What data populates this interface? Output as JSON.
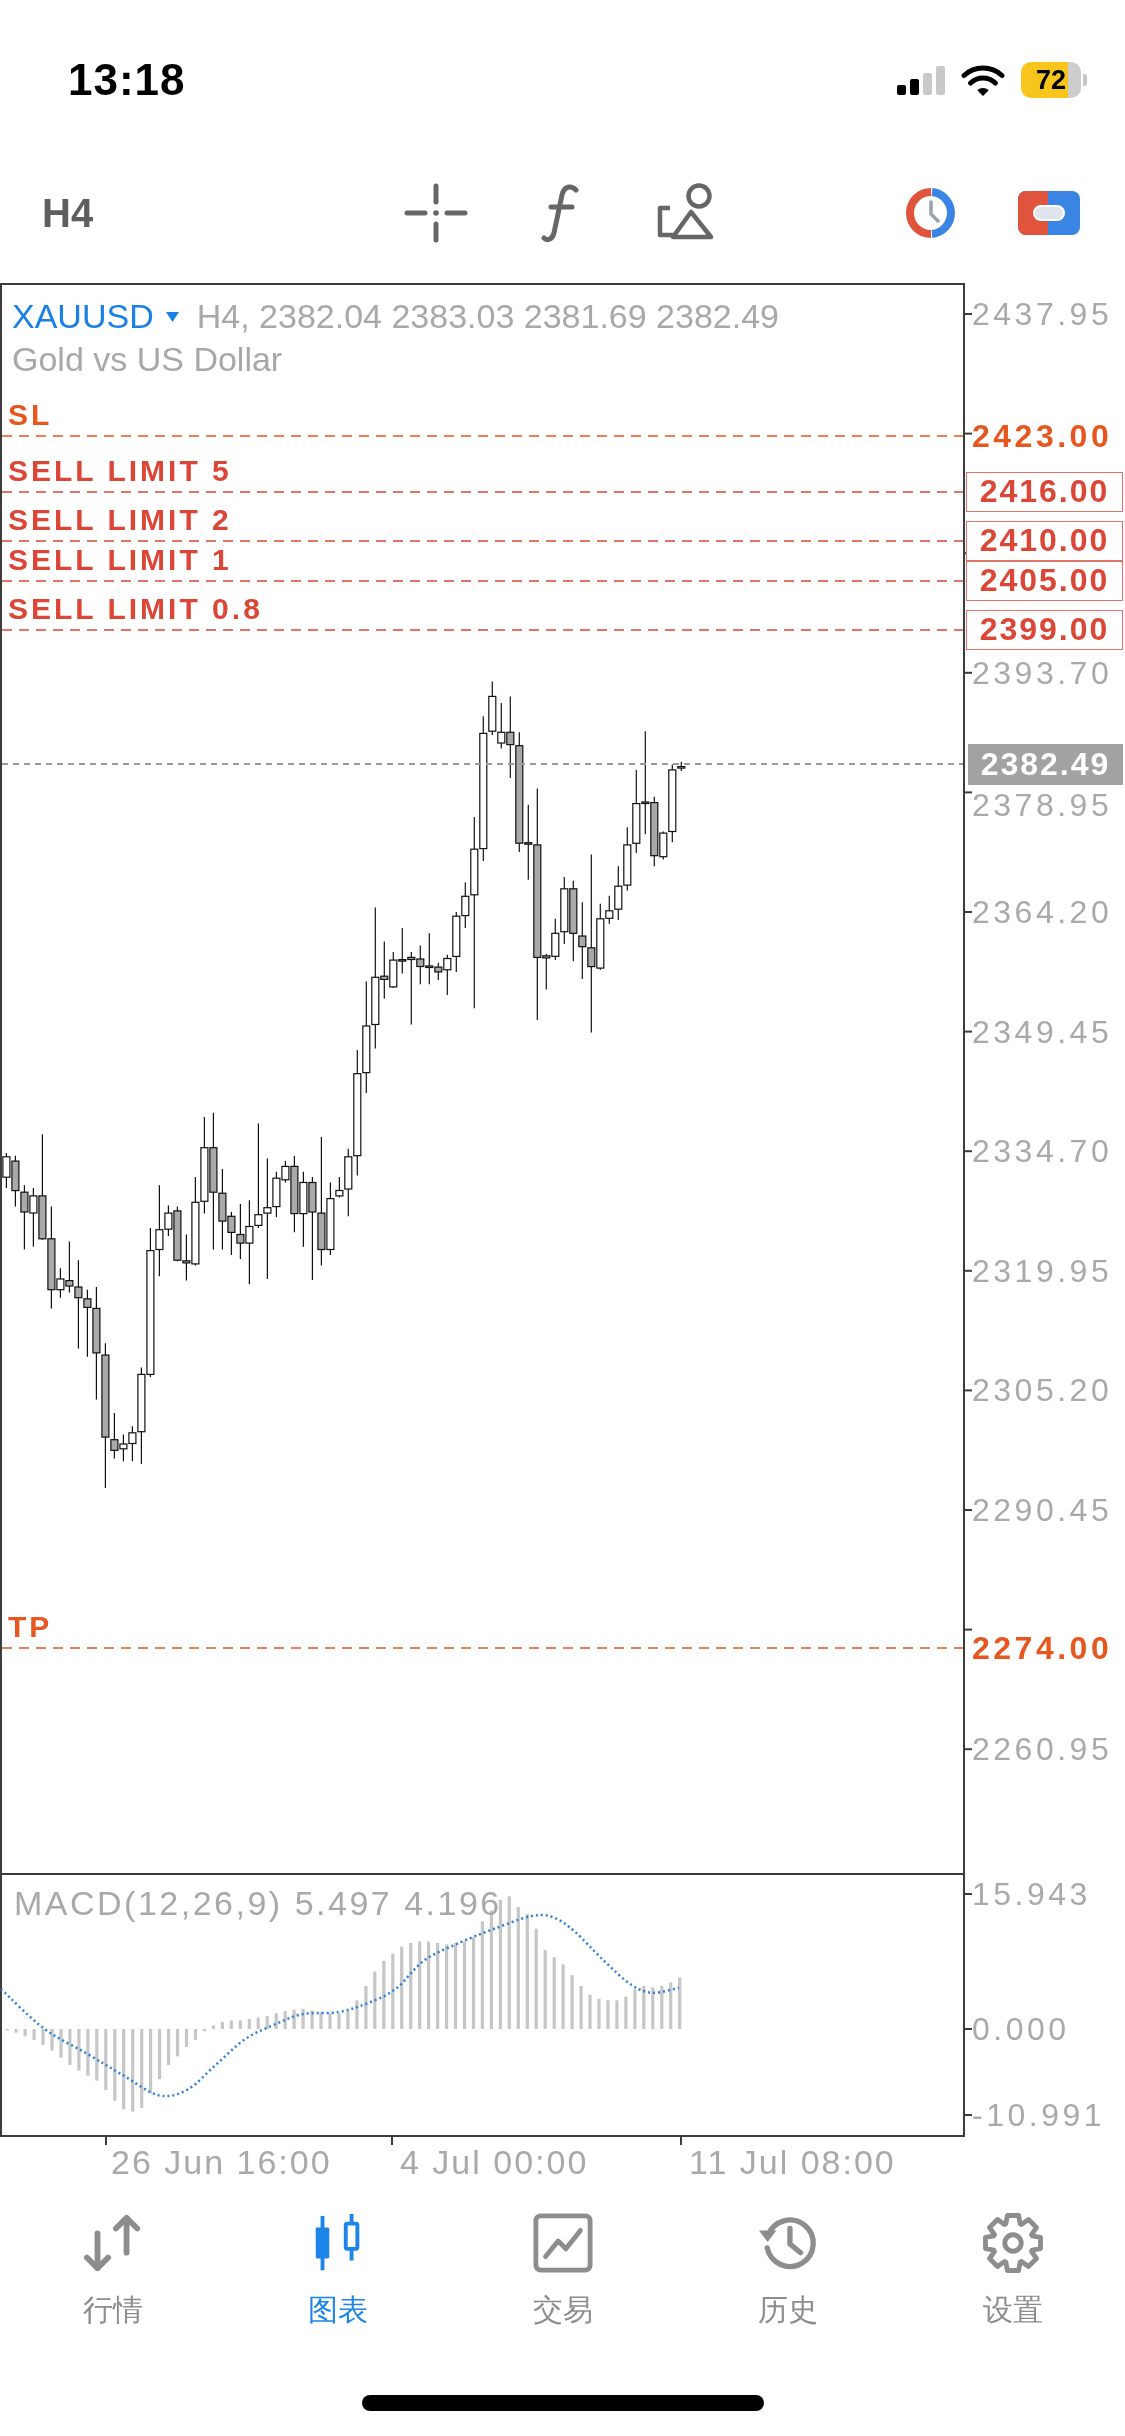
{
  "status_bar": {
    "time": "13:18",
    "battery": "72"
  },
  "toolbar": {
    "timeframe": "H4"
  },
  "chart": {
    "symbol": "XAUUSD",
    "quote": "H4, 2382.04 2383.03 2381.69 2382.49",
    "description": "Gold vs US Dollar",
    "order_lines": [
      {
        "label": "SL",
        "price": "2423.00",
        "kind": "sl"
      },
      {
        "label": "SELL LIMIT 5",
        "price": "2416.00",
        "kind": "limit"
      },
      {
        "label": "SELL LIMIT 2",
        "price": "2410.00",
        "kind": "limit"
      },
      {
        "label": "SELL LIMIT 1",
        "price": "2405.00",
        "kind": "limit"
      },
      {
        "label": "SELL LIMIT 0.8",
        "price": "2399.00",
        "kind": "limit"
      },
      {
        "label": "TP",
        "price": "2274.00",
        "kind": "tp"
      }
    ],
    "current_price": "2382.49",
    "price_axis": [
      "2437.95",
      "2393.70",
      "2378.95",
      "2364.20",
      "2349.45",
      "2334.70",
      "2319.95",
      "2305.20",
      "2290.45",
      "2260.95"
    ]
  },
  "indicator": {
    "title": "MACD(12,26,9) 5.497 4.196",
    "axis": [
      "15.943",
      "0.000",
      "-10.991"
    ]
  },
  "time_axis": [
    "26 Jun 16:00",
    "4 Jul 00:00",
    "11 Jul 08:00"
  ],
  "tabs": [
    {
      "label": "行情",
      "selected": false
    },
    {
      "label": "图表",
      "selected": true
    },
    {
      "label": "交易",
      "selected": false
    },
    {
      "label": "历史",
      "selected": false
    },
    {
      "label": "设置",
      "selected": false
    }
  ]
}
